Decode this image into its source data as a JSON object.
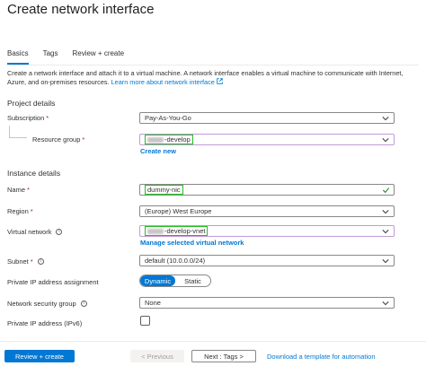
{
  "page": {
    "title": "Create network interface"
  },
  "tabs": [
    {
      "label": "Basics",
      "active": true
    },
    {
      "label": "Tags",
      "active": false
    },
    {
      "label": "Review + create",
      "active": false
    }
  ],
  "description": {
    "text": "Create a network interface and attach it to a virtual machine. A network interface enables a virtual machine to communicate with Internet, Azure, and on-premises resources. ",
    "link": "Learn more about network interface"
  },
  "project_details": {
    "heading": "Project details",
    "subscription": {
      "label": "Subscription",
      "value": "Pay-As-You-Go"
    },
    "resource_group": {
      "label": "Resource group",
      "value": "-develop",
      "create_new": "Create new"
    }
  },
  "instance_details": {
    "heading": "Instance details",
    "name": {
      "label": "Name",
      "value": "dummy-nic"
    },
    "region": {
      "label": "Region",
      "value": "(Europe) West Europe"
    },
    "virtual_network": {
      "label": "Virtual network",
      "value": "-develop-vnet",
      "manage_link": "Manage selected virtual network"
    },
    "subnet": {
      "label": "Subnet",
      "value": "default (10.0.0.0/24)"
    },
    "private_ip_assignment": {
      "label": "Private IP address assignment",
      "options": [
        "Dynamic",
        "Static"
      ],
      "selected": "Dynamic"
    },
    "nsg": {
      "label": "Network security group",
      "value": "None"
    },
    "ipv6": {
      "label": "Private IP address (IPv6)",
      "checked": false
    }
  },
  "footer": {
    "review_create": "Review + create",
    "previous": "< Previous",
    "next": "Next : Tags >",
    "download": "Download a template for automation"
  },
  "colors": {
    "accent": "#0078d4",
    "highlight": "#22c01f",
    "required": "#a4262c",
    "valid_check": "#107c10"
  }
}
